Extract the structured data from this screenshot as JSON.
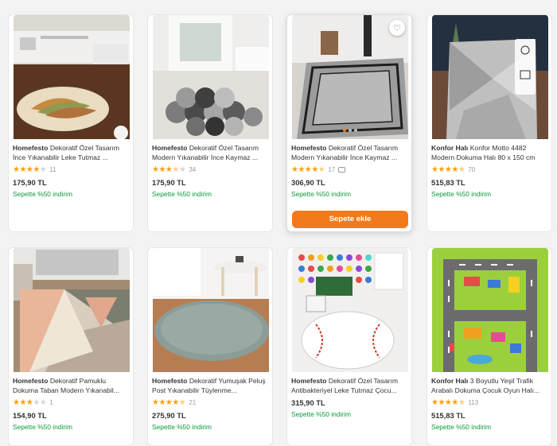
{
  "products": [
    {
      "brand": "Homefesto",
      "name": "Dekoratif Özel Tasarım İnce Yıkanabilir Leke Tutmaz ...",
      "stars": 4,
      "rating_count": "11",
      "price": "175,90 TL",
      "promo": "Sepette %50 indirim",
      "image_icon": "oval-leaf-rug"
    },
    {
      "brand": "Homefesto",
      "name": "Dekoratif Özel Tasarım Modern Yıkanabilir İnce Kaymaz ...",
      "stars": 3.5,
      "rating_count": "34",
      "price": "175,90 TL",
      "promo": "Sepette %50 indirim",
      "image_icon": "circles-rug"
    },
    {
      "brand": "Homefesto",
      "name": "Dekoratif Özel Tasarım Modern Yıkanabilir İnce Kaymaz ...",
      "stars": 4.5,
      "rating_count": "17",
      "price": "306,90 TL",
      "promo": "Sepette %50 indirim",
      "add_to_cart": "Sepete ekle",
      "image_icon": "grey-border-rug"
    },
    {
      "brand": "Konfor Halı",
      "name": "Konfor Motto 4482 Modern Dokuma Halı 80 x 150 cm",
      "stars": 4.5,
      "rating_count": "70",
      "price": "515,83 TL",
      "promo": "Sepette %50 indirim",
      "image_icon": "geometric-grey-rug"
    },
    {
      "brand": "Homefesto",
      "name": "Dekoratif Pamuklu Dokuma Taban Modern Yıkanabil...",
      "stars": 3,
      "rating_count": "1",
      "price": "154,90 TL",
      "promo": "Sepette %50 indirim",
      "image_icon": "triangle-rug"
    },
    {
      "brand": "Homefesto",
      "name": "Dekoratif Yumuşak Peluş Post Yıkanabilir Tüylenme...",
      "stars": 4.5,
      "rating_count": "21",
      "price": "275,90 TL",
      "promo": "Sepette %50 indirim",
      "image_icon": "round-plush-rug"
    },
    {
      "brand": "Homefesto",
      "name": "Dekoratif Özel Tasarım Antibakteriyel Leke Tutmaz Çocu...",
      "stars": null,
      "rating_count": "",
      "price": "315,90 TL",
      "promo": "Sepette %50 indirim",
      "image_icon": "baseball-rug"
    },
    {
      "brand": "Konfor Halı",
      "name": "3 Boyutlu Yeşil Trafik Arabalı Dokuma Çocuk Oyun Halı...",
      "stars": 4.5,
      "rating_count": "113",
      "price": "515,83 TL",
      "promo": "Sepette %50 indirim",
      "image_icon": "traffic-play-rug"
    }
  ],
  "colors": {
    "accent": "#f27a1a",
    "star": "#ff9f00",
    "promo": "#0a9a3a"
  }
}
